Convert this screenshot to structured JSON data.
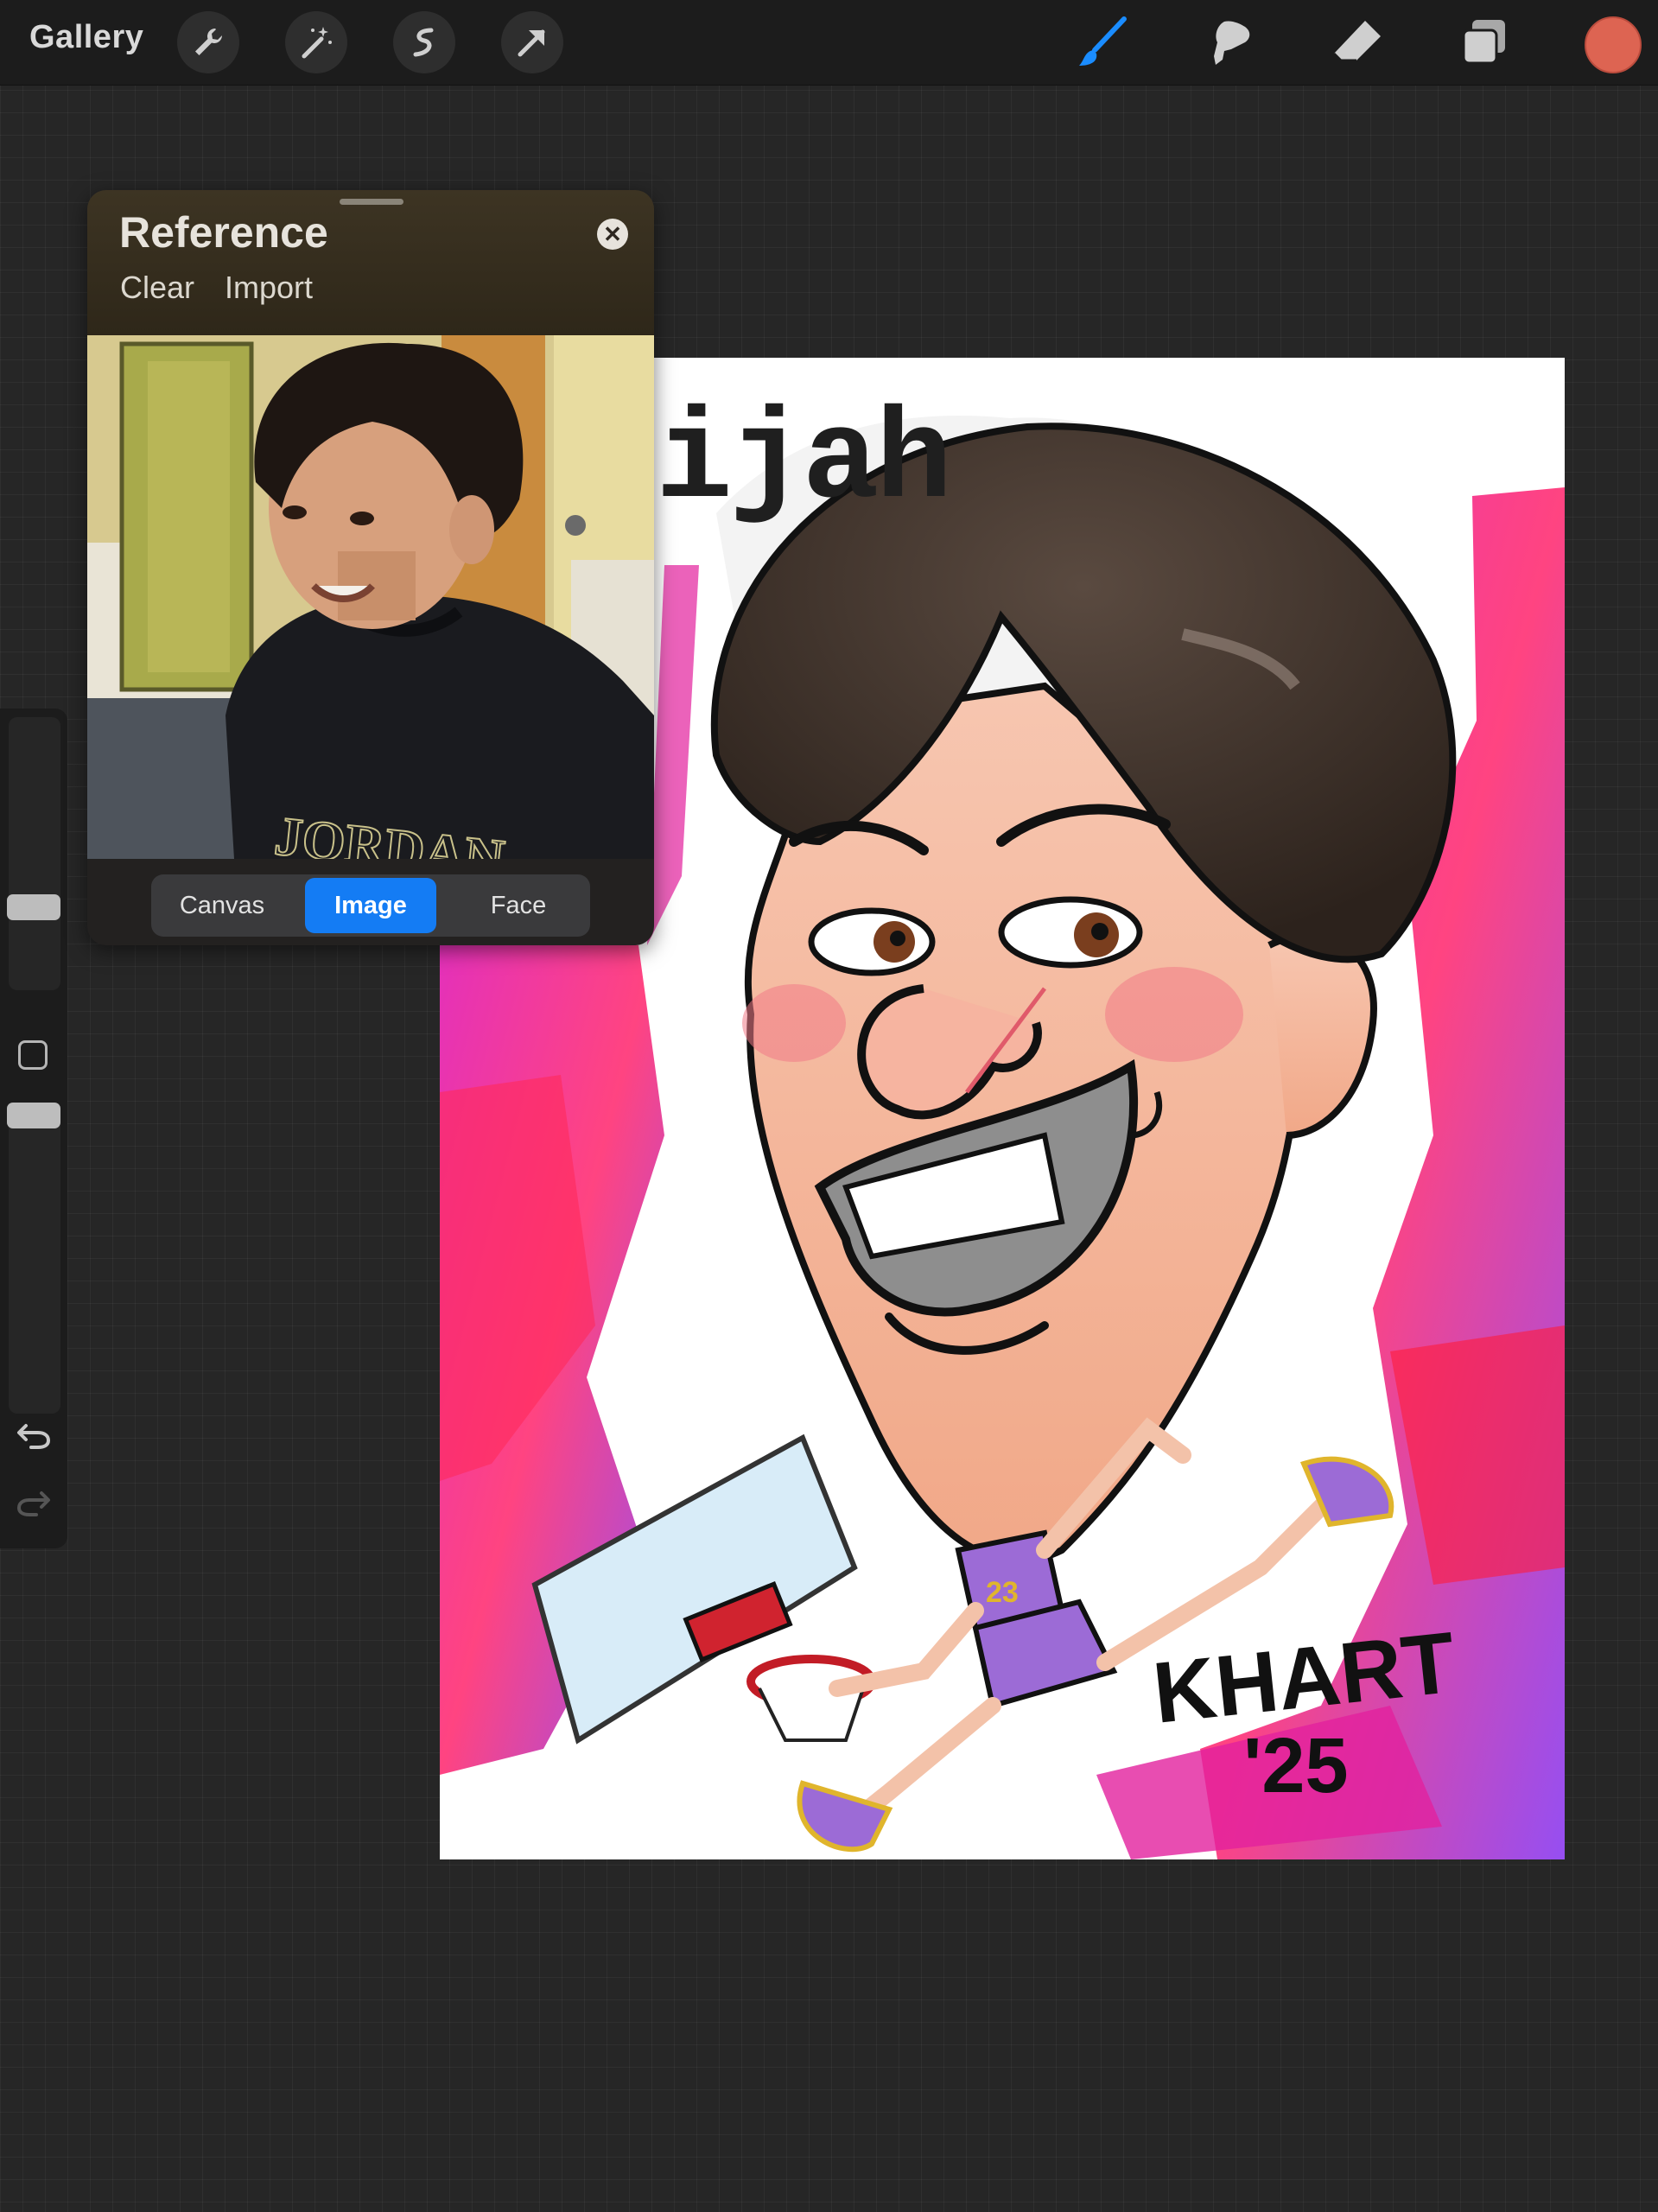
{
  "toolbar": {
    "gallery_label": "Gallery",
    "left_tools": [
      "wrench-icon",
      "magic-wand-icon",
      "selection-icon",
      "transform-arrow-icon"
    ],
    "right_tools": [
      "brush-icon",
      "smudge-icon",
      "eraser-icon",
      "layers-icon"
    ],
    "active_tool": "brush-icon",
    "active_color": "#dd6452",
    "accent_color": "#1a8cff"
  },
  "sidebar": {
    "brush_size_level": 0.7,
    "opacity_level": 0.95,
    "undo_icon": "undo-icon",
    "redo_icon": "redo-icon"
  },
  "reference": {
    "title": "Reference",
    "clear_label": "Clear",
    "import_label": "Import",
    "close_icon": "close-icon",
    "photo_shirt_text": "JORDAN",
    "tabs": [
      {
        "label": "Canvas",
        "active": false
      },
      {
        "label": "Image",
        "active": true
      },
      {
        "label": "Face",
        "active": false
      }
    ]
  },
  "artwork": {
    "name_text": "ijah",
    "jersey_number": "23",
    "signature": "KHART",
    "signature_year": "'25"
  }
}
